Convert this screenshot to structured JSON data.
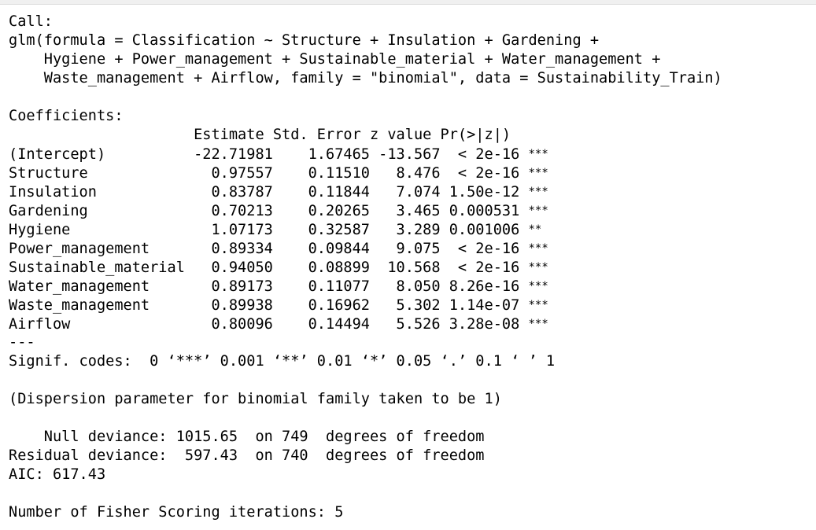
{
  "call": {
    "label": "Call:",
    "lines": [
      "glm(formula = Classification ~ Structure + Insulation + Gardening + ",
      "    Hygiene + Power_management + Sustainable_material + Water_management + ",
      "    Waste_management + Airflow, family = \"binomial\", data = Sustainability_Train)"
    ]
  },
  "coefficients": {
    "label": "Coefficients:",
    "header": "                     Estimate Std. Error z value Pr(>|z|)    ",
    "rows": [
      {
        "name": "(Intercept)",
        "text": "(Intercept)          -22.71981    1.67465 -13.567  < 2e-16 ",
        "stars": "***"
      },
      {
        "name": "Structure",
        "text": "Structure              0.97557    0.11510   8.476  < 2e-16 ",
        "stars": "***"
      },
      {
        "name": "Insulation",
        "text": "Insulation             0.83787    0.11844   7.074 1.50e-12 ",
        "stars": "***"
      },
      {
        "name": "Gardening",
        "text": "Gardening              0.70213    0.20265   3.465 0.000531 ",
        "stars": "***"
      },
      {
        "name": "Hygiene",
        "text": "Hygiene                1.07173    0.32587   3.289 0.001006 ",
        "stars": "**"
      },
      {
        "name": "Power_management",
        "text": "Power_management       0.89334    0.09844   9.075  < 2e-16 ",
        "stars": "***"
      },
      {
        "name": "Sustainable_material",
        "text": "Sustainable_material   0.94050    0.08899  10.568  < 2e-16 ",
        "stars": "***"
      },
      {
        "name": "Water_management",
        "text": "Water_management       0.89173    0.11077   8.050 8.26e-16 ",
        "stars": "***"
      },
      {
        "name": "Waste_management",
        "text": "Waste_management       0.89938    0.16962   5.302 1.14e-07 ",
        "stars": "***"
      },
      {
        "name": "Airflow",
        "text": "Airflow                0.80096    0.14494   5.526 3.28e-08 ",
        "stars": "***"
      }
    ],
    "separator": "---",
    "signif": "Signif. codes:  0 ‘***’ 0.001 ‘**’ 0.01 ‘*’ 0.05 ‘.’ 0.1 ‘ ’ 1"
  },
  "dispersion": "(Dispersion parameter for binomial family taken to be 1)",
  "deviance": {
    "null": "    Null deviance: 1015.65  on 749  degrees of freedom",
    "residual": "Residual deviance:  597.43  on 740  degrees of freedom",
    "aic": "AIC: 617.43"
  },
  "iterations": "Number of Fisher Scoring iterations: 5"
}
